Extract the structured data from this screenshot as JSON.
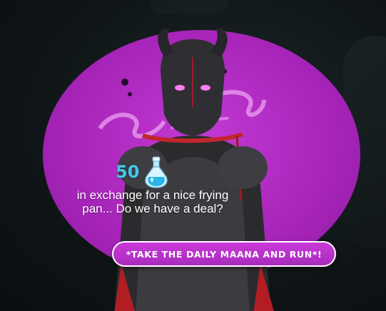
{
  "reward": {
    "amount": "50",
    "icon": "potion-icon"
  },
  "dialog": {
    "text": "in exchange for a nice frying pan... Do we have a deal?"
  },
  "action_button": {
    "label": "*TAKE THE DAILY MAANA AND RUN*!"
  },
  "colors": {
    "bubble": "#b52fc7",
    "button_fill": "#c13ad2",
    "reward_text": "#49c6e6",
    "background": "#0e1416"
  }
}
